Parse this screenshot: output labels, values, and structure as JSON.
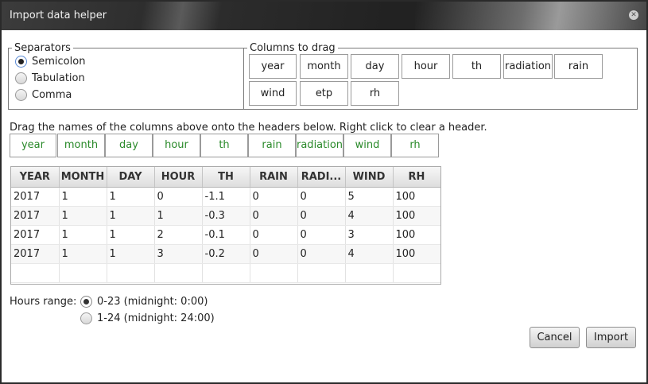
{
  "window": {
    "title": "Import data helper"
  },
  "separators": {
    "legend": "Separators",
    "options": [
      {
        "label": "Semicolon",
        "checked": true
      },
      {
        "label": "Tabulation",
        "checked": false
      },
      {
        "label": "Comma",
        "checked": false
      }
    ]
  },
  "columns_to_drag": {
    "legend": "Columns to drag",
    "chips": [
      "year",
      "month",
      "day",
      "hour",
      "th",
      "radiation",
      "rain",
      "wind",
      "etp",
      "rh"
    ]
  },
  "hint": "Drag the names of the columns above onto the headers below. Right click to clear a header.",
  "target_headers": [
    "year",
    "month",
    "day",
    "hour",
    "th",
    "rain",
    "radiation",
    "wind",
    "rh"
  ],
  "table": {
    "columns": [
      "YEAR",
      "MONTH",
      "DAY",
      "HOUR",
      "TH",
      "RAIN",
      "RADI...",
      "WIND",
      "RH"
    ],
    "rows": [
      [
        "2017",
        "1",
        "1",
        "0",
        "-1.1",
        "0",
        "0",
        "5",
        "100"
      ],
      [
        "2017",
        "1",
        "1",
        "1",
        "-0.3",
        "0",
        "0",
        "4",
        "100"
      ],
      [
        "2017",
        "1",
        "1",
        "2",
        "-0.1",
        "0",
        "0",
        "3",
        "100"
      ],
      [
        "2017",
        "1",
        "1",
        "3",
        "-0.2",
        "0",
        "0",
        "4",
        "100"
      ]
    ]
  },
  "hours_range": {
    "label": "Hours range:",
    "options": [
      {
        "label": "0-23 (midnight: 0:00)",
        "checked": true
      },
      {
        "label": "1-24 (midnight: 24:00)",
        "checked": false
      }
    ]
  },
  "buttons": {
    "cancel": "Cancel",
    "import": "Import"
  }
}
